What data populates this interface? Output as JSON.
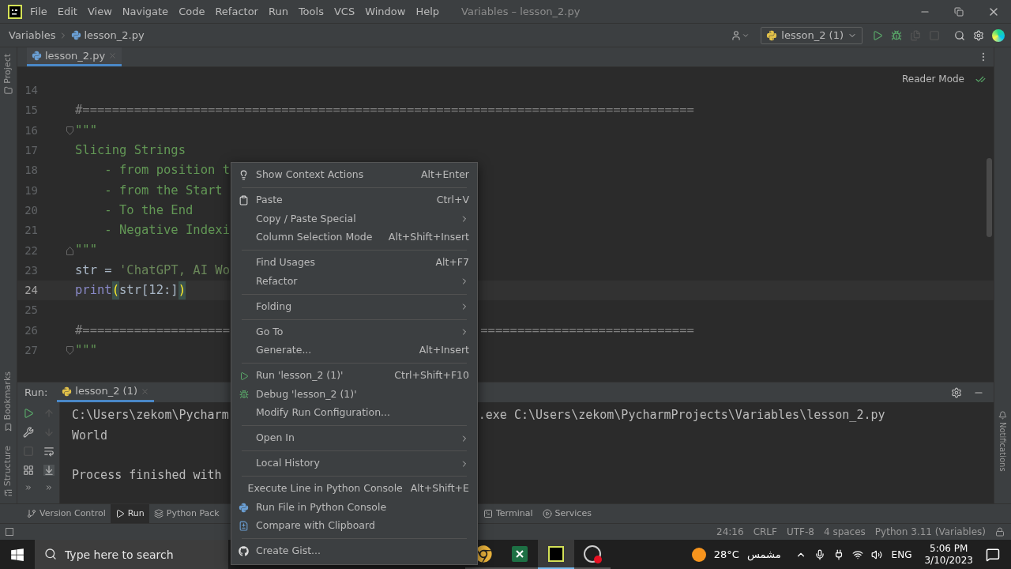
{
  "window": {
    "title": "Variables – lesson_2.py",
    "menu": [
      "File",
      "Edit",
      "View",
      "Navigate",
      "Code",
      "Refactor",
      "Run",
      "Tools",
      "VCS",
      "Window",
      "Help"
    ]
  },
  "breadcrumb": [
    "Variables",
    "lesson_2.py"
  ],
  "run_config": {
    "label": "lesson_2 (1)"
  },
  "left_stripe": {
    "top": [
      "Project"
    ],
    "bottom": [
      "Bookmarks",
      "Structure"
    ]
  },
  "right_stripe": [
    "Notifications"
  ],
  "editor_tabs": [
    {
      "label": "lesson_2.py",
      "selected": true
    }
  ],
  "reader_mode": "Reader Mode",
  "code_lines": [
    {
      "number": "14",
      "current": false
    },
    {
      "number": "15",
      "current": false,
      "parts": [
        {
          "kind": "comment",
          "text": "#==================================================================================="
        }
      ]
    },
    {
      "number": "16",
      "current": false,
      "fold_open": true,
      "parts": [
        {
          "kind": "docstring",
          "text": "\"\"\""
        }
      ]
    },
    {
      "number": "17",
      "current": false,
      "parts": [
        {
          "kind": "docstring",
          "text": "Slicing Strings"
        }
      ]
    },
    {
      "number": "18",
      "current": false,
      "parts": [
        {
          "kind": "docstring",
          "text": "    - from position t"
        }
      ]
    },
    {
      "number": "19",
      "current": false,
      "parts": [
        {
          "kind": "docstring",
          "text": "    - from the Start"
        }
      ]
    },
    {
      "number": "20",
      "current": false,
      "parts": [
        {
          "kind": "docstring",
          "text": "    - To the End"
        }
      ]
    },
    {
      "number": "21",
      "current": false,
      "parts": [
        {
          "kind": "docstring",
          "text": "    - Negative Indexi"
        }
      ]
    },
    {
      "number": "22",
      "current": false,
      "fold_close": true,
      "parts": [
        {
          "kind": "docstring",
          "text": "\"\"\""
        }
      ]
    },
    {
      "number": "23",
      "current": false,
      "parts": [
        {
          "kind": "plain",
          "text": "str = "
        },
        {
          "kind": "string",
          "text": "'ChatGPT, AI Wo"
        }
      ]
    },
    {
      "number": "24",
      "current": true,
      "parts": [
        {
          "kind": "keyword",
          "text": "print"
        },
        {
          "kind": "bracket",
          "text": "("
        },
        {
          "kind": "plain",
          "text": "str[12:]"
        },
        {
          "kind": "bracket",
          "text": ")"
        }
      ]
    },
    {
      "number": "25",
      "current": false
    },
    {
      "number": "26",
      "current": false,
      "parts": [
        {
          "kind": "comment",
          "text": "#===================="
        }
      ],
      "parts_right": [
        {
          "kind": "comment",
          "text": "============================="
        }
      ]
    },
    {
      "number": "27",
      "current": false,
      "fold_open": true,
      "parts": [
        {
          "kind": "docstring",
          "text": "\"\"\""
        }
      ]
    }
  ],
  "run_panel": {
    "title": "Run:",
    "tabs": [
      {
        "label": "lesson_2 (1)",
        "selected": true
      }
    ],
    "console": [
      {
        "text": "C:\\Users\\zekom\\Pycharm",
        "text_right": ".exe C:\\Users\\zekom\\PycharmProjects\\Variables\\lesson_2.py",
        "blank_before": false
      },
      {
        "text": "World",
        "blank_before": false
      },
      {
        "text": "Process finished with",
        "blank_before": true
      }
    ]
  },
  "tool_windows_left": [
    {
      "label": "Version Control",
      "selected": false
    },
    {
      "label": "Run",
      "selected": true
    },
    {
      "label": "Python Pack",
      "selected": false
    }
  ],
  "tool_windows_right": [
    {
      "label": "Terminal",
      "selected": false
    },
    {
      "label": "Services",
      "selected": false
    }
  ],
  "status_bar": [
    "24:16",
    "CRLF",
    "UTF-8",
    "4 spaces",
    "Python 3.11 (Variables)"
  ],
  "context_menu": [
    {
      "kind": "item",
      "label": "Show Context Actions",
      "shortcut": "Alt+Enter",
      "submenu": false
    },
    {
      "kind": "separator"
    },
    {
      "kind": "item",
      "label": "Paste",
      "shortcut": "Ctrl+V",
      "submenu": false
    },
    {
      "kind": "item",
      "label": "Copy / Paste Special",
      "submenu": true
    },
    {
      "kind": "item",
      "label": "Column Selection Mode",
      "shortcut": "Alt+Shift+Insert",
      "submenu": false
    },
    {
      "kind": "separator"
    },
    {
      "kind": "item",
      "label": "Find Usages",
      "shortcut": "Alt+F7",
      "submenu": false
    },
    {
      "kind": "item",
      "label": "Refactor",
      "submenu": true
    },
    {
      "kind": "separator"
    },
    {
      "kind": "item",
      "label": "Folding",
      "submenu": true
    },
    {
      "kind": "separator"
    },
    {
      "kind": "item",
      "label": "Go To",
      "submenu": true
    },
    {
      "kind": "item",
      "label": "Generate...",
      "shortcut": "Alt+Insert",
      "submenu": false
    },
    {
      "kind": "separator"
    },
    {
      "kind": "item",
      "label": "Run 'lesson_2 (1)'",
      "shortcut": "Ctrl+Shift+F10",
      "submenu": false
    },
    {
      "kind": "item",
      "label": "Debug 'lesson_2 (1)'",
      "submenu": false
    },
    {
      "kind": "item",
      "label": "Modify Run Configuration...",
      "submenu": false
    },
    {
      "kind": "separator"
    },
    {
      "kind": "item",
      "label": "Open In",
      "submenu": true
    },
    {
      "kind": "separator"
    },
    {
      "kind": "item",
      "label": "Local History",
      "submenu": true
    },
    {
      "kind": "separator"
    },
    {
      "kind": "item",
      "label": "Execute Line in Python Console",
      "shortcut": "Alt+Shift+E",
      "submenu": false
    },
    {
      "kind": "item",
      "label": "Run File in Python Console",
      "submenu": false
    },
    {
      "kind": "item",
      "label": "Compare with Clipboard",
      "submenu": false
    },
    {
      "kind": "separator"
    },
    {
      "kind": "item",
      "label": "Create Gist...",
      "submenu": false
    }
  ],
  "taskbar": {
    "search": {
      "placeholder": "Type here to search"
    },
    "apps": [
      {
        "selected": false
      },
      {
        "selected": false
      },
      {
        "selected": true
      },
      {
        "selected": false
      }
    ],
    "weather": {
      "temperature": "28°C",
      "condition": "مشمس"
    },
    "language": "ENG",
    "time": "5:06 PM",
    "date": "3/10/2023"
  }
}
